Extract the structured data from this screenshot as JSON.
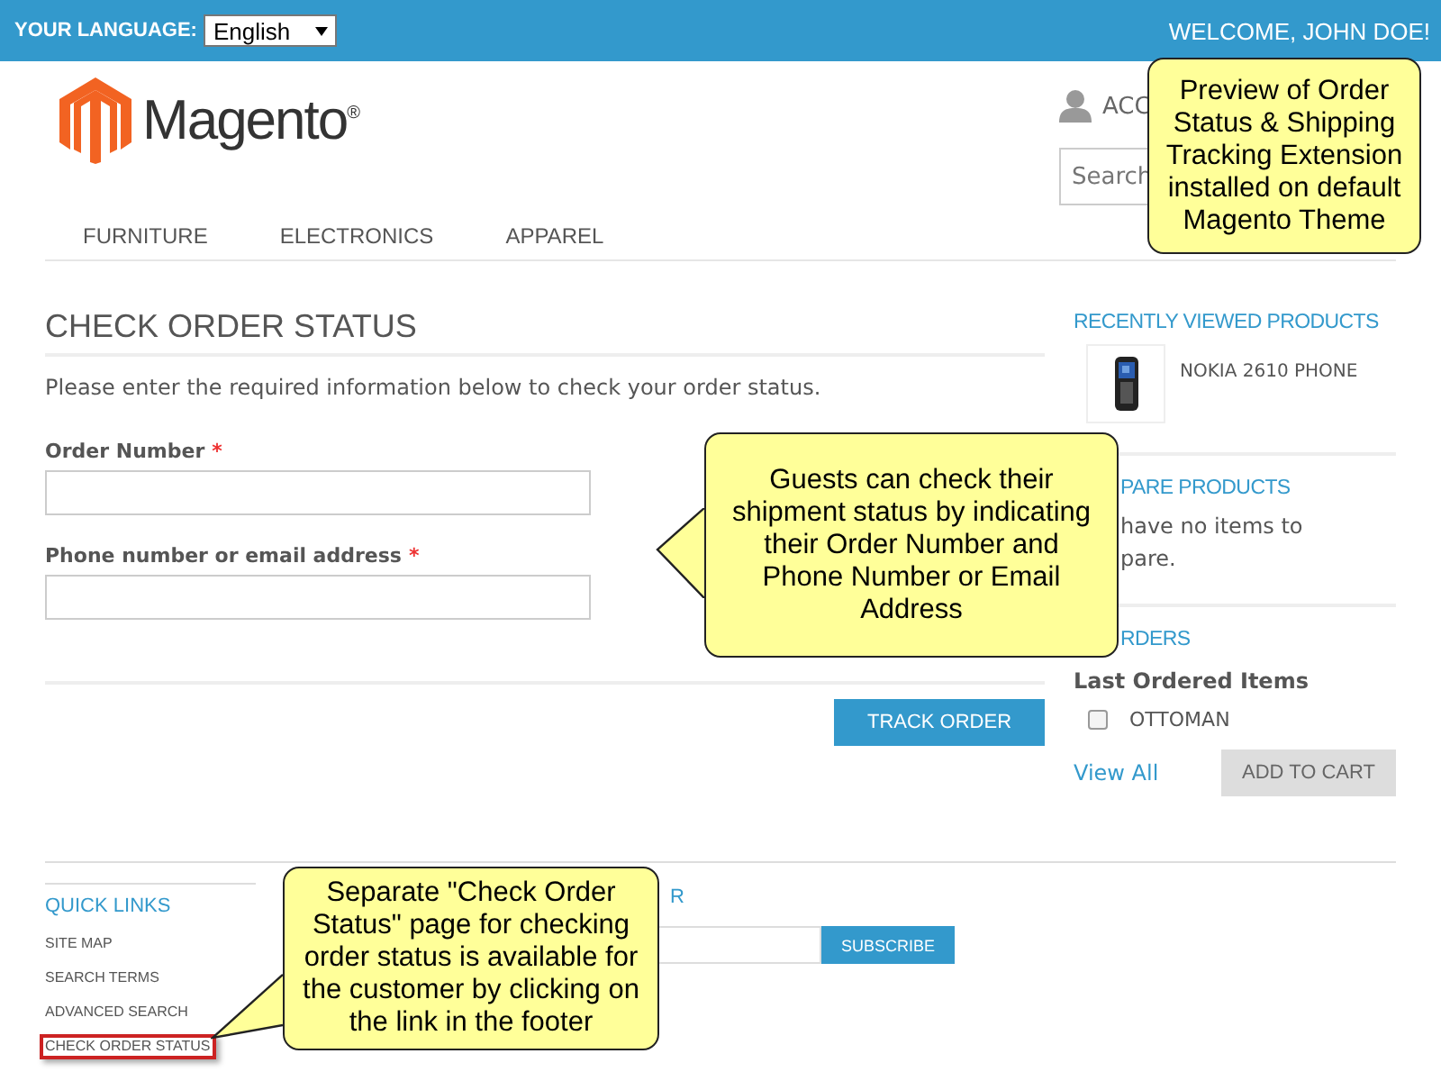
{
  "top_bar": {
    "language_label": "YOUR LANGUAGE:",
    "language_value": "English",
    "welcome": "WELCOME, JOHN DOE!"
  },
  "header": {
    "logo_text": "Magento",
    "logo_mark": "®",
    "account_link": "ACC",
    "search": {
      "placeholder": "Search"
    }
  },
  "nav": [
    {
      "label": "FURNITURE"
    },
    {
      "label": "ELECTRONICS"
    },
    {
      "label": "APPAREL"
    }
  ],
  "main": {
    "title": "CHECK ORDER STATUS",
    "intro": "Please enter the required information below to check your order status.",
    "fields": [
      {
        "label": "Order Number",
        "required_mark": "*"
      },
      {
        "label": "Phone number or email address",
        "required_mark": "*"
      }
    ],
    "button": "TRACK ORDER"
  },
  "sidebar": {
    "recently_viewed": {
      "title": "RECENTLY VIEWED PRODUCTS",
      "products": [
        {
          "name": "NOKIA 2610 PHONE",
          "kind": "picture"
        }
      ]
    },
    "compare": {
      "title": "PARE PRODUCTS",
      "message": [
        "have no items to",
        "pare."
      ]
    },
    "orders": {
      "title": "RDERS",
      "subtitle": "Last Ordered Items",
      "items": [
        {
          "name": "OTTOMAN",
          "checked": false
        }
      ],
      "view_all": "View All",
      "add_to_cart": "ADD TO CART"
    }
  },
  "footer": {
    "quick_links": {
      "title": "QUICK LINKS",
      "links": [
        {
          "label": "SITE MAP",
          "highlighted": false
        },
        {
          "label": "SEARCH TERMS",
          "highlighted": false
        },
        {
          "label": "ADVANCED SEARCH",
          "highlighted": false
        },
        {
          "label": "CHECK ORDER STATUS",
          "highlighted": true
        }
      ]
    },
    "newsletter": {
      "title": "R",
      "button": "SUBSCRIBE"
    }
  },
  "callouts": [
    {
      "text": "Preview of Order Status & Shipping Tracking Extension installed on default Magento Theme",
      "kind": "plain"
    },
    {
      "text": "Guests can check their shipment status by indicating their Order Number and Phone Number or Email Address",
      "kind": "left"
    },
    {
      "text": "Separate \"Check Order Status\" page for checking order status is available for the customer by clicking on the link in the footer",
      "kind": "lowerleft"
    }
  ]
}
